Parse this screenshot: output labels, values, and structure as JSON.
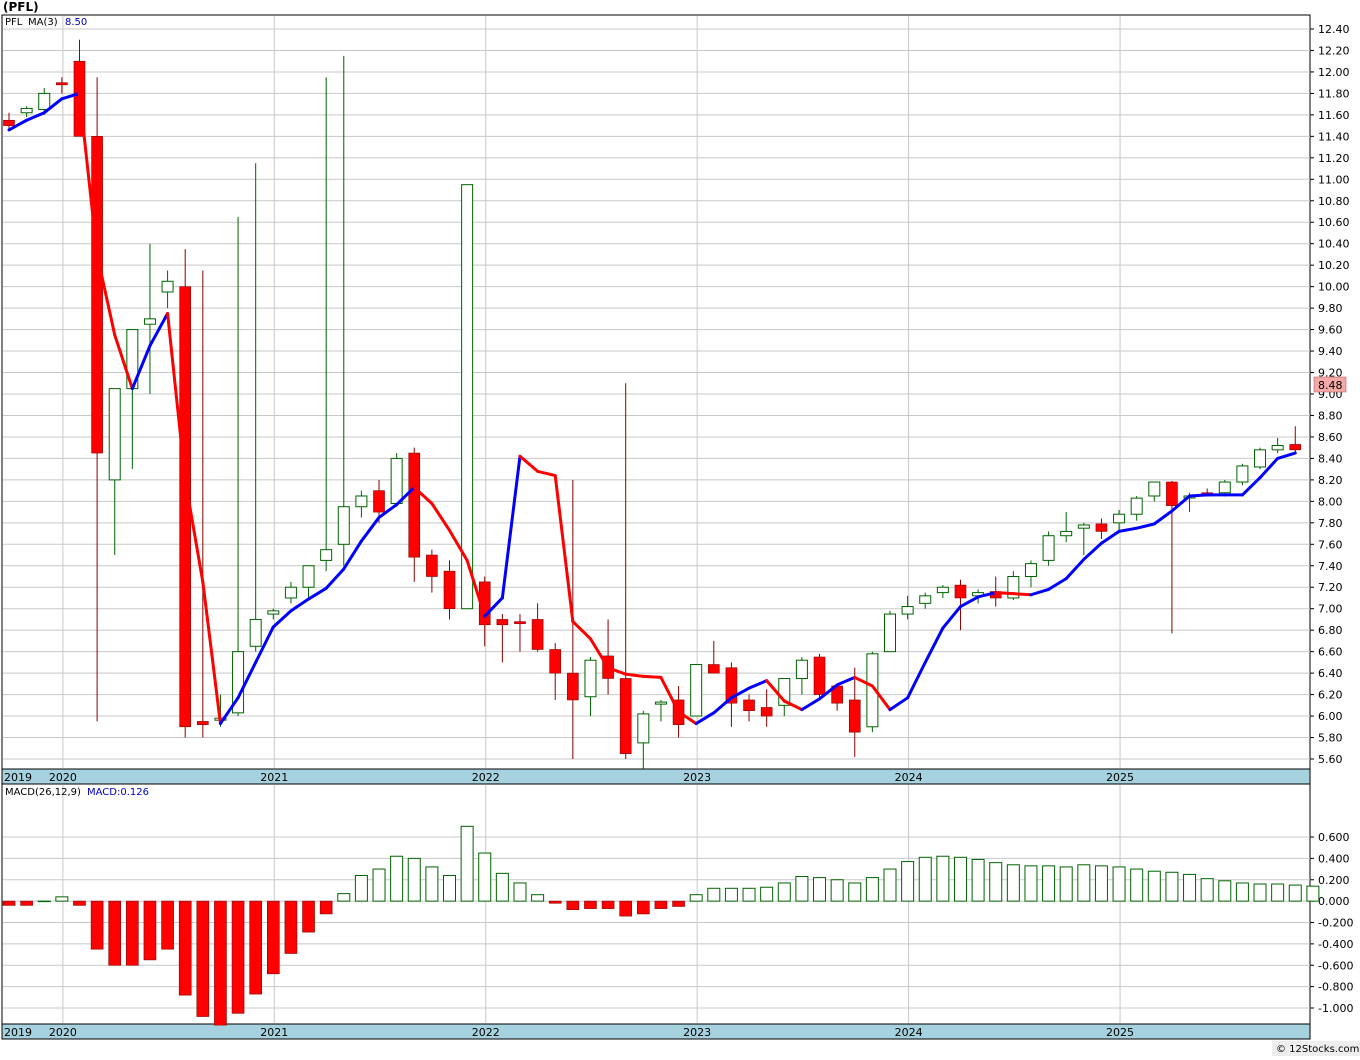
{
  "header": {
    "symbol_title": "(PFL)"
  },
  "price_panel": {
    "legend_symbol": "PFL",
    "ma_label": "MA(3)",
    "ma_value": "8.50",
    "last_price_tag": "8.48"
  },
  "macd_panel": {
    "label": "MACD(26,12,9)",
    "value_label": "MACD:0.126"
  },
  "footer": {
    "copyright": "© 12Stocks.com"
  },
  "colors": {
    "up_candle_border": "#006400",
    "down_candle_fill": "#ff0000",
    "ma_up": "#0000ff",
    "ma_down": "#ff0000",
    "macd_pos": "#006400",
    "macd_neg": "#ff0000",
    "year_band": "#a6d1de",
    "price_tag_bg": "#f4a8a8"
  },
  "chart_data": [
    {
      "type": "candlestick",
      "title": "(PFL)",
      "period": "monthly",
      "ylim": [
        5.5,
        12.5
      ],
      "y_ticks": [
        "12.40",
        "12.20",
        "12.00",
        "11.80",
        "11.60",
        "11.40",
        "11.20",
        "11.00",
        "10.80",
        "10.60",
        "10.40",
        "10.20",
        "10.00",
        "9.80",
        "9.60",
        "9.40",
        "9.20",
        "9.00",
        "8.80",
        "8.60",
        "8.40",
        "8.20",
        "8.00",
        "7.80",
        "7.60",
        "7.40",
        "7.20",
        "7.00",
        "6.80",
        "6.60",
        "6.40",
        "6.20",
        "6.00",
        "5.80",
        "5.60"
      ],
      "x_labels": [
        "2019",
        "2020",
        "2021",
        "2022",
        "2023",
        "2024",
        "2025"
      ],
      "series": [
        {
          "name": "PFL",
          "ohlc": [
            [
              11.55,
              11.62,
              11.45,
              11.5
            ],
            [
              11.62,
              11.68,
              11.58,
              11.66
            ],
            [
              11.65,
              11.85,
              11.6,
              11.8
            ],
            [
              11.9,
              11.95,
              11.8,
              11.88
            ],
            [
              12.1,
              12.3,
              11.8,
              11.4
            ],
            [
              11.4,
              11.95,
              5.95,
              8.45
            ],
            [
              8.2,
              9.05,
              7.5,
              9.05
            ],
            [
              9.05,
              9.6,
              8.3,
              9.6
            ],
            [
              9.65,
              10.4,
              9.0,
              9.7
            ],
            [
              9.95,
              10.15,
              9.8,
              10.05
            ],
            [
              10.0,
              10.35,
              5.8,
              5.9
            ],
            [
              5.95,
              10.15,
              5.8,
              5.92
            ],
            [
              5.97,
              6.2,
              5.9,
              5.98
            ],
            [
              6.03,
              10.65,
              6.0,
              6.6
            ],
            [
              6.65,
              11.15,
              6.6,
              6.9
            ],
            [
              6.95,
              7.0,
              6.9,
              6.98
            ],
            [
              7.1,
              7.25,
              7.05,
              7.2
            ],
            [
              7.2,
              7.4,
              7.1,
              7.4
            ],
            [
              7.45,
              11.95,
              7.35,
              7.55
            ],
            [
              7.6,
              12.15,
              7.4,
              7.95
            ],
            [
              7.95,
              8.1,
              7.85,
              8.05
            ],
            [
              8.1,
              8.2,
              7.8,
              7.9
            ],
            [
              7.98,
              8.45,
              7.95,
              8.4
            ],
            [
              8.45,
              8.5,
              7.25,
              7.48
            ],
            [
              7.5,
              7.55,
              7.15,
              7.3
            ],
            [
              7.35,
              7.45,
              6.9,
              7.0
            ],
            [
              7.0,
              10.95,
              7.0,
              10.95
            ],
            [
              7.25,
              7.3,
              6.65,
              6.85
            ],
            [
              6.9,
              6.95,
              6.5,
              6.85
            ],
            [
              6.88,
              6.95,
              6.6,
              6.86
            ],
            [
              6.9,
              7.05,
              6.6,
              6.62
            ],
            [
              6.62,
              6.68,
              6.15,
              6.4
            ],
            [
              6.4,
              8.2,
              5.6,
              6.15
            ],
            [
              6.18,
              6.55,
              6.0,
              6.52
            ],
            [
              6.56,
              6.9,
              6.2,
              6.35
            ],
            [
              6.35,
              9.1,
              5.6,
              5.65
            ],
            [
              5.75,
              6.05,
              5.5,
              6.02
            ],
            [
              6.12,
              6.15,
              5.95,
              6.13
            ],
            [
              6.15,
              6.28,
              5.8,
              5.92
            ],
            [
              6.0,
              6.48,
              6.0,
              6.48
            ],
            [
              6.48,
              6.7,
              6.4,
              6.4
            ],
            [
              6.45,
              6.5,
              5.9,
              6.12
            ],
            [
              6.15,
              6.2,
              5.95,
              6.05
            ],
            [
              6.08,
              6.25,
              5.9,
              6.0
            ],
            [
              6.1,
              6.35,
              6.0,
              6.35
            ],
            [
              6.35,
              6.55,
              6.2,
              6.52
            ],
            [
              6.55,
              6.58,
              6.15,
              6.2
            ],
            [
              6.28,
              6.3,
              6.05,
              6.12
            ],
            [
              6.15,
              6.45,
              5.62,
              5.85
            ],
            [
              5.9,
              6.6,
              5.85,
              6.58
            ],
            [
              6.6,
              6.98,
              6.6,
              6.95
            ],
            [
              6.95,
              7.12,
              6.9,
              7.02
            ],
            [
              7.05,
              7.15,
              7.0,
              7.12
            ],
            [
              7.15,
              7.22,
              7.1,
              7.2
            ],
            [
              7.22,
              7.27,
              6.8,
              7.1
            ],
            [
              7.12,
              7.18,
              7.05,
              7.15
            ],
            [
              7.16,
              7.3,
              7.02,
              7.1
            ],
            [
              7.1,
              7.35,
              7.08,
              7.3
            ],
            [
              7.3,
              7.45,
              7.2,
              7.42
            ],
            [
              7.45,
              7.72,
              7.4,
              7.68
            ],
            [
              7.68,
              7.9,
              7.62,
              7.72
            ],
            [
              7.75,
              7.8,
              7.5,
              7.78
            ],
            [
              7.79,
              7.84,
              7.65,
              7.72
            ],
            [
              7.8,
              7.92,
              7.72,
              7.88
            ],
            [
              7.88,
              8.05,
              7.82,
              8.03
            ],
            [
              8.05,
              8.18,
              8.0,
              8.18
            ],
            [
              8.18,
              8.19,
              6.77,
              7.96
            ],
            [
              8.05,
              8.08,
              7.9,
              8.05
            ],
            [
              8.08,
              8.12,
              8.05,
              8.05
            ],
            [
              8.08,
              8.2,
              8.05,
              8.18
            ],
            [
              8.18,
              8.35,
              8.15,
              8.33
            ],
            [
              8.32,
              8.5,
              8.3,
              8.48
            ],
            [
              8.48,
              8.59,
              8.45,
              8.52
            ],
            [
              8.53,
              8.7,
              8.45,
              8.48
            ]
          ]
        },
        {
          "name": "MA(3)",
          "values": [
            11.46,
            11.55,
            11.62,
            11.75,
            11.8,
            10.3,
            9.55,
            9.05,
            9.45,
            9.75,
            8.2,
            7.25,
            5.93,
            6.17,
            6.5,
            6.83,
            6.98,
            7.09,
            7.19,
            7.37,
            7.63,
            7.85,
            7.97,
            8.13,
            7.98,
            7.73,
            7.45,
            6.93,
            7.1,
            8.42,
            8.28,
            8.24,
            6.88,
            6.72,
            6.45,
            6.39,
            6.37,
            6.36,
            6.04,
            5.93,
            6.03,
            6.17,
            6.26,
            6.33,
            6.14,
            6.06,
            6.16,
            6.29,
            6.36,
            6.28,
            6.06,
            6.17,
            6.5,
            6.82,
            7.02,
            7.11,
            7.15,
            7.14,
            7.13,
            7.18,
            7.28,
            7.46,
            7.61,
            7.72,
            7.75,
            7.79,
            7.91,
            8.05,
            8.06,
            8.06,
            8.06,
            8.22,
            8.4,
            8.45
          ]
        }
      ],
      "notes_last_price": 8.48
    },
    {
      "type": "bar",
      "title": "MACD(26,12,9)",
      "ylim": [
        -1.1,
        0.75
      ],
      "y_ticks": [
        "0.600",
        "0.400",
        "0.200",
        "0.000",
        "-0.200",
        "-0.400",
        "-0.600",
        "-0.800",
        "-1.000"
      ],
      "x_labels": [
        "2019",
        "2020",
        "2021",
        "2022",
        "2023",
        "2024",
        "2025"
      ],
      "series": [
        {
          "name": "MACD",
          "values": [
            -0.04,
            -0.04,
            0.0,
            0.04,
            -0.04,
            -0.45,
            -0.6,
            -0.6,
            -0.55,
            -0.45,
            -0.88,
            -1.08,
            -1.16,
            -1.05,
            -0.87,
            -0.68,
            -0.49,
            -0.29,
            -0.12,
            0.07,
            0.24,
            0.3,
            0.42,
            0.4,
            0.32,
            0.24,
            0.7,
            0.45,
            0.26,
            0.17,
            0.06,
            -0.02,
            -0.08,
            -0.07,
            -0.07,
            -0.14,
            -0.12,
            -0.07,
            -0.05,
            0.06,
            0.12,
            0.12,
            0.12,
            0.13,
            0.17,
            0.23,
            0.22,
            0.2,
            0.17,
            0.22,
            0.3,
            0.37,
            0.41,
            0.42,
            0.41,
            0.39,
            0.36,
            0.34,
            0.33,
            0.33,
            0.32,
            0.34,
            0.33,
            0.32,
            0.3,
            0.28,
            0.27,
            0.25,
            0.21,
            0.19,
            0.17,
            0.16,
            0.16,
            0.15,
            0.14
          ]
        }
      ]
    }
  ]
}
